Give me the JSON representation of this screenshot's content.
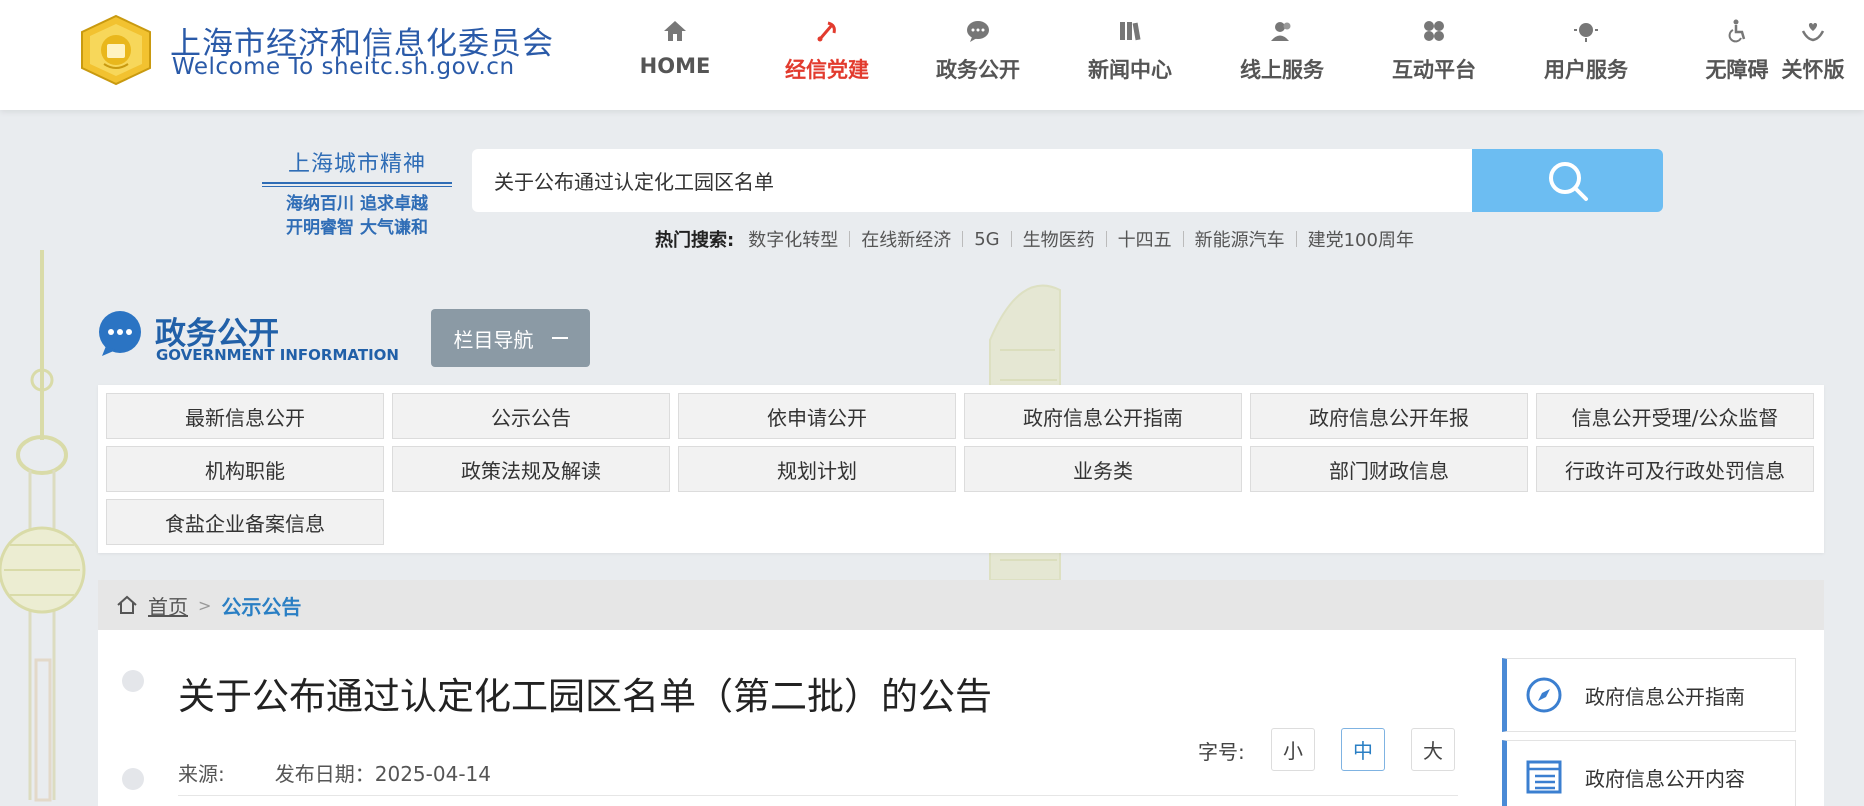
{
  "header": {
    "site_name_cn": "上海市经济和信息化委员会",
    "site_name_en": "Welcome To sheitc.sh.gov.cn",
    "nav": [
      {
        "label": "HOME",
        "icon": "home-icon"
      },
      {
        "label": "经信党建",
        "icon": "party-emblem-icon",
        "active": true
      },
      {
        "label": "政务公开",
        "icon": "chat-bubble-icon"
      },
      {
        "label": "新闻中心",
        "icon": "books-icon"
      },
      {
        "label": "线上服务",
        "icon": "users-icon"
      },
      {
        "label": "互动平台",
        "icon": "puzzle-icon"
      },
      {
        "label": "用户服务",
        "icon": "globe-icon"
      },
      {
        "label": "无障碍",
        "icon": "accessibility-icon"
      },
      {
        "label": "关怀版",
        "icon": "care-hands-icon"
      }
    ],
    "active_color": "#e23b2e"
  },
  "spirit": {
    "title": "上海城市精神",
    "line1": "海纳百川 追求卓越",
    "line2": "开明睿智 大气谦和"
  },
  "search": {
    "value": "关于公布通过认定化工园区名单",
    "hot_label": "热门搜索:",
    "hot_terms": [
      "数字化转型",
      "在线新经济",
      "5G",
      "生物医药",
      "十四五",
      "新能源汽车",
      "建党100周年"
    ]
  },
  "section": {
    "title": "政务公开",
    "subtitle": "GOVERNMENT INFORMATION",
    "column_nav_label": "栏目导航"
  },
  "categories": [
    "最新信息公开",
    "公示公告",
    "依申请公开",
    "政府信息公开指南",
    "政府信息公开年报",
    "信息公开受理/公众监督",
    "机构职能",
    "政策法规及解读",
    "规划计划",
    "业务类",
    "部门财政信息",
    "行政许可及行政处罚信息",
    "食盐企业备案信息"
  ],
  "breadcrumb": {
    "home": "首页",
    "separator": ">",
    "current": "公示公告"
  },
  "article": {
    "title": "关于公布通过认定化工园区名单（第二批）的公告",
    "source_label": "来源:",
    "date_text": "发布日期：2025-04-14",
    "font_size_label": "字号:",
    "font_sizes": [
      "小",
      "中",
      "大"
    ],
    "font_size_selected": "中"
  },
  "sidebar": {
    "links": [
      "政府信息公开指南",
      "政府信息公开内容"
    ]
  },
  "colors": {
    "brand_blue": "#2160a8",
    "search_button": "#6cbdf2",
    "link_blue": "#2a7fc4"
  }
}
